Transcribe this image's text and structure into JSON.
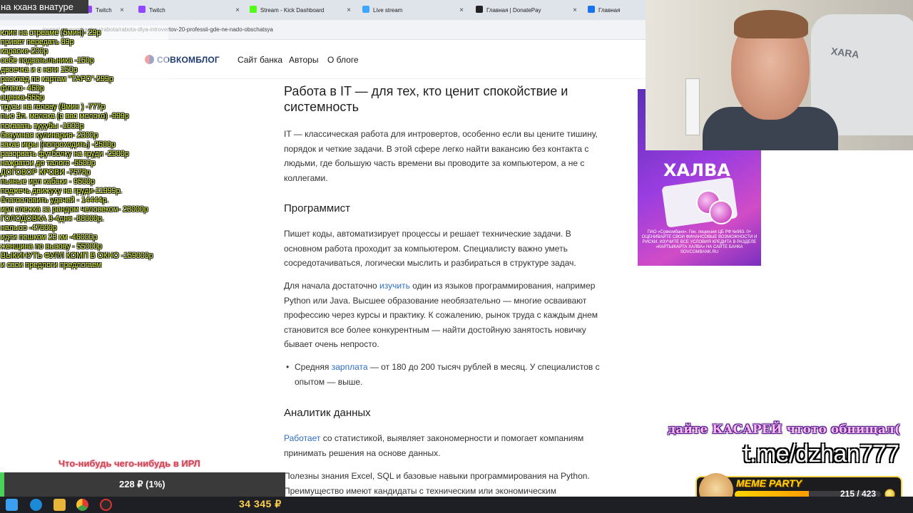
{
  "browser": {
    "tabs": [
      {
        "label": "Twitch",
        "color": "#9146ff"
      },
      {
        "label": "Twitch",
        "color": "#9146ff"
      },
      {
        "label": "Stream - Kick Dashboard",
        "color": "#53fc18"
      },
      {
        "label": "Live stream",
        "color": "#3ea6ff"
      },
      {
        "label": "Главная | DonatePay",
        "color": "#222222"
      },
      {
        "label": "Главная",
        "color": "#1a73e8"
      }
    ],
    "url": "journal.sovcombank.ru/rabota/rabota-dlya-introvertov-20-professii-gde-ne-nado-obschatsya"
  },
  "site": {
    "logo": "СОВКОМБЛОГ",
    "nav": [
      "Сайт банка",
      "Авторы",
      "О блоге"
    ]
  },
  "article": {
    "heading": "Работа в IT — для тех, кто ценит спокойствие и системность",
    "intro_lines": [
      "IT — классическая работа для интровертов, особенно если вы цените тишину,",
      "порядок и четкие задачи. В этой сфере легко найти вакансию без контакта с",
      "людьми, где большую часть времени вы проводите за компьютером, а не с",
      "коллегами."
    ],
    "section1_title": "Программист",
    "section1_p1_lines": [
      "Пишет коды, автоматизирует процессы и решает технические задачи. В",
      "основном работа проходит за компьютером. Специалисту важно уметь",
      "сосредотачиваться, логически мыслить и разбираться в структуре задач."
    ],
    "section1_p2_line1_pre": "Для начала достаточно ",
    "section1_p2_link": "изучить",
    "section1_p2_line1_post": " один из языков программирования, например",
    "section1_p2_lines": [
      "Python или Java. Высшее образование необязательно — многие осваивают",
      "профессию через курсы и практику. К сожалению, рынок труда с каждым днем",
      "становится все более конкурентным — найти достойную занятость новичку",
      "бывает очень непросто."
    ],
    "salary_pre": "Средняя ",
    "salary_link": "зарплата",
    "salary_post": " — от 180 до 200 тысяч рублей в месяц. У специалистов с",
    "salary_line2": "опытом — выше.",
    "section2_title": "Аналитик данных",
    "section2_link": "Работает",
    "section2_line1_post": " со статистикой, выявляет закономерности и помогает компаниям",
    "section2_line2": "принимать решения на основе данных.",
    "section2_p2_lines": [
      "Полезны знания Excel, SQL и базовые навыки программирования на Python.",
      "Преимущество имеют кандидаты с техническим или экономическим"
    ]
  },
  "banner": {
    "title": "ХАЛВА",
    "text": "ПАО «Совкомбанк». Ген. лицензия ЦБ РФ №963. 0+ ОЦЕНИВАЙТЕ СВОИ ФИНАНСОВЫЕ ВОЗМОЖНОСТИ И РИСКИ. ИЗУЧИТЕ ВСЕ УСЛОВИЯ КРЕДИТА В РАЗДЕЛЕ «КАРТЫ/КАРТА ХАЛВА» НА САЙТЕ БАНКА SOVCOMBANK.RU"
  },
  "webcam": {
    "chair_brand": "XARA"
  },
  "overlay": {
    "top_label": "на кханз внатуре",
    "price_list": [
      "клип на стреаме (5мин)- 29р",
      "привет передать 89р",
      "караоке-200р",
      "себе подзатыльника -150р",
      "двоечка и с ноги 150р",
      "расклад по картам \"ТАРО\"-299р",
      "флекс- 450р",
      "сценка-555р",
      "трусы на голову (8мин ) -777р",
      "пью 3л. молока (с вас молоко) -999р",
      "показать зууубы -1000р",
      "безумная кулинария- 2300р",
      "заказ игры (попроходить) -2500р",
      "разорвать футболку на груди -2900р",
      "нажратси до талого -5500р",
      "ДОГОВОР КРОВИ -7578р",
      "пьяные ирл кабаки - 9500р",
      "поджечь движуху на груди-11999р.",
      "благословить удачей - 14444р.",
      "ирл слежка за рандом человеком- 23000р",
      "ГОЛОДОВКА 3-4дня -38000р.",
      "налысо -47000р",
      "идти пешком 23 км -46000р",
      "женщина по вызову - 55000р",
      "ВЫКИНУТЬ ФУЛЛ КОМП В ОКНО -159000р",
      "и свои предлоги предлогаем"
    ],
    "irl_text": "Что-нибудь чего-нибудь в ИРЛ",
    "goal_text": "228 ₽ (1%)",
    "goal_fraction": 0.01,
    "taskbar_money": "34 345 ₽",
    "kasarei_text": "дайте КАСАРЕЙ чтото обнищал(",
    "telegram": "t.me/dzhan777",
    "meme_party_title": "MEME PARTY",
    "meme_count": "215 / 423",
    "meme_fraction": 0.508
  }
}
